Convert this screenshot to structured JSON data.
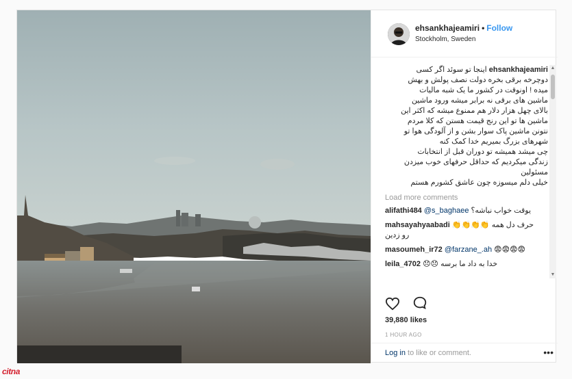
{
  "post": {
    "username": "ehsankhajeamiri",
    "separator": "•",
    "follow_label": "Follow",
    "location": "Stockholm, Sweden",
    "caption_user": "ehsankhajeamiri",
    "caption_lines": [
      "اینجا تو سوئد اگر کسی",
      "دوچرخه برقی بخره دولت نصف پولش و بهش",
      "میده ! اونوقت در کشور ما یک شبه مالیات",
      "ماشین های برقی نه برابر میشه ورود ماشین",
      "بالای چهل هزار دلار هم ممنوع میشه که اکثر این",
      "ماشین ها تو این رنج قیمت هستن که کلا مردم",
      "نتونن ماشین پاک سوار بشن و از آلودگی هوا تو",
      "شهرهای بزرگ بمیریم خدا کمک کنه",
      "چی میشد همیشه تو دوران قبل از انتخابات",
      "زندگی میکردیم که حداقل حرفهای خوب میزدن",
      "مسئولین",
      "خیلی دلم میسوزه چون عاشق کشورم هستم"
    ],
    "load_more_label": "Load more comments",
    "comments": [
      {
        "user": "alifathi484",
        "mention": "@s_baghaee",
        "text": "یوقت خواب نباشه؟"
      },
      {
        "user": "mahsayahyaabadi",
        "text": "👏👏👏👏 حرف دل همه",
        "text2": "رو زدین"
      },
      {
        "user": "masoumeh_ir72",
        "mention": "@farzane_.ah",
        "text": "😨😨😨😨"
      },
      {
        "user": "leila_4702",
        "text": "😞😞 خدا به داد ما برسه"
      }
    ],
    "likes": "39,880 likes",
    "time": "1 HOUR AGO",
    "login_link": "Log in",
    "login_rest": " to like or comment.",
    "more_options": "•••",
    "icons": {
      "like": "heart-icon",
      "comment": "comment-bubble-icon",
      "more": "more-options-icon"
    }
  },
  "watermark": "citna"
}
